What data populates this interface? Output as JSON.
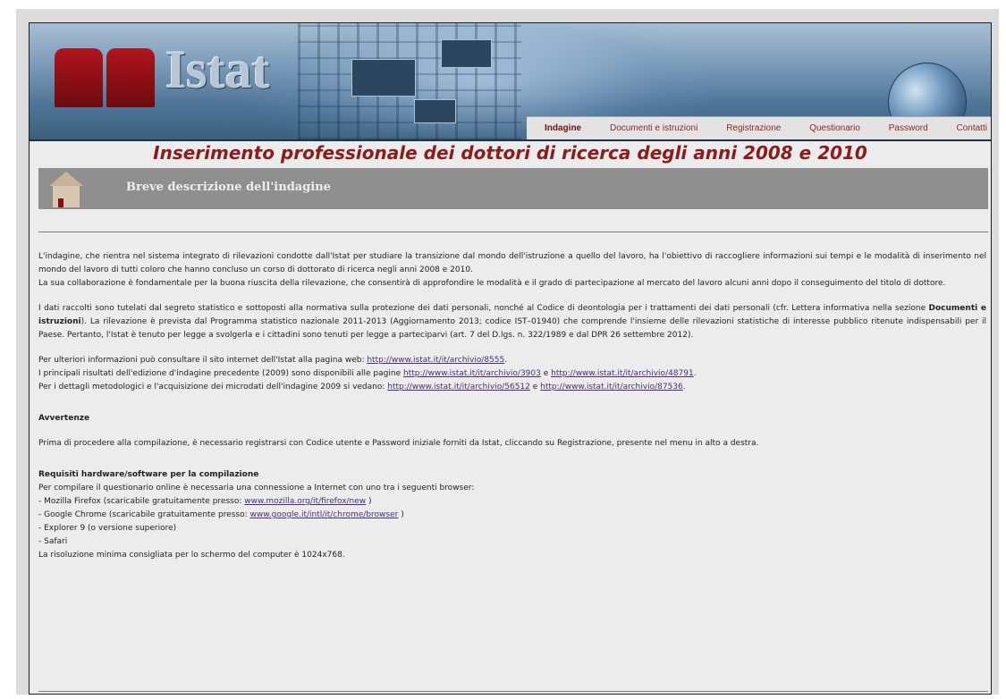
{
  "header": {
    "logo_text": "Istat",
    "nav": [
      "Indagine",
      "Documenti e istruzioni",
      "Registrazione",
      "Questionario",
      "Password",
      "Contatti"
    ]
  },
  "main": {
    "title": "Inserimento professionale dei dottori di ricerca degli anni 2008 e 2010",
    "section_title": "Breve descrizione dell'indagine",
    "p1": "L'indagine, che rientra nel sistema integrato di rilevazioni condotte dall'Istat per studiare la transizione dal mondo dell'istruzione a quello del lavoro, ha l'obiettivo di raccogliere informazioni sui tempi e le modalità di inserimento nel mondo del lavoro di tutti coloro che hanno concluso un corso di dottorato di ricerca negli anni 2008 e 2010.",
    "p2": "La sua collaborazione è fondamentale per la buona riuscita della rilevazione, che consentirà di approfondire le modalità e il grado di partecipazione al mercato del lavoro alcuni anni dopo il conseguimento del titolo di dottore.",
    "p3_a": "I dati raccolti sono tutelati dal segreto statistico e sottoposti alla normativa sulla protezione dei dati personali, nonché al Codice di deontologia per i trattamenti dei dati personali (cfr. Lettera informativa nella sezione ",
    "p3_bold": "Documenti e istruzioni",
    "p3_b": "). La rilevazione è prevista dal Programma statistico nazionale 2011-2013 (Aggiornamento 2013; codice IST–01940) che comprende l'insieme delle rilevazioni statistiche di interesse pubblico ritenute indispensabili per il Paese. Pertanto, l'Istat è tenuto per legge a svolgerla e i cittadini sono tenuti per legge a parteciparvi (art. 7 del D.lgs. n. 322/1989 e dal DPR 26 settembre 2012).",
    "links": {
      "l1_text": "Per ulteriori informazioni può consultare il sito internet dell'Istat alla pagina web: ",
      "l1_url": "http://www.istat.it/it/archivio/8555",
      "l2_text": "I principali risultati dell'edizione d'indagine precedente (2009) sono disponibili alle pagine ",
      "l2_url1": "http://www.istat.it/it/archivio/3903",
      "l2_and": " e ",
      "l2_url2": "http://www.istat.it/it/archivio/48791",
      "l3_text": "Per i dettagli metodologici e l'acquisizione dei microdati dell'indagine 2009 si vedano: ",
      "l3_url1": "http://www.istat.it/it/archivio/56512",
      "l3_and": " e ",
      "l3_url2": "http://www.istat.it/it/archivio/87536"
    },
    "warn_heading": "Avvertenze",
    "warn_text": "Prima di procedere alla compilazione, è necessario registrarsi con Codice utente e Password iniziale forniti da Istat, cliccando su Registrazione, presente nel menu in alto a destra.",
    "req_heading": "Requisiti hardware/software per la compilazione",
    "req_intro": "Per compilare il questionario online è necessaria una connessione a Internet con uno tra i seguenti browser:",
    "req_firefox": "- Mozilla Firefox  (scaricabile gratuitamente presso:  ",
    "req_firefox_url": "www.mozilla.org/it/firefox/new",
    "req_chrome": "- Google Chrome (scaricabile gratuitamente presso:  ",
    "req_chrome_url": "www.google.it/intl/it/chrome/browser",
    "req_explorer": "- Explorer 9 (o versione superiore)",
    "req_safari": "- Safari",
    "req_resolution": "La risoluzione minima consigliata per lo schermo del computer è 1024x768."
  }
}
